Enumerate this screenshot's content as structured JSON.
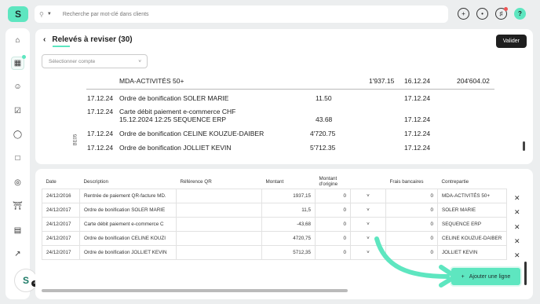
{
  "app": {
    "logo_text": "S"
  },
  "search": {
    "placeholder": "Recherche par mot-clé dans clients"
  },
  "top_icons": [
    "add-circle-icon",
    "clock-icon",
    "bell-icon",
    "help-icon"
  ],
  "help_label": "?",
  "sidebar": {
    "items": [
      "home-icon",
      "inbox-icon",
      "users-icon",
      "checklist-icon",
      "money-bag-icon",
      "shopping-bag-icon",
      "support-icon",
      "bank-icon",
      "document-icon",
      "chart-icon"
    ]
  },
  "avatar": {
    "initials": "S",
    "badge": "42"
  },
  "page": {
    "title": "Relevés à reviser (30)",
    "validate_label": "Valider",
    "account_select_placeholder": "Sélectionner compte"
  },
  "scan": {
    "side_code": "BE05",
    "rows": [
      {
        "label": "MDA-ACTIVITÉS 50+",
        "amount": "1'937.15",
        "date": "16.12.24",
        "balance": "204'604.02"
      },
      {
        "date1": "17.12.24",
        "label": "Ordre de bonification SOLER MARIE",
        "amount": "11.50",
        "date2": "17.12.24"
      },
      {
        "date1": "17.12.24",
        "label": "Carte débit paiement e-commerce CHF",
        "label2": "15.12.2024 12:25 SEQUENCE ERP",
        "amount": "43.68",
        "date2": "17.12.24"
      },
      {
        "date1": "17.12.24",
        "label": "Ordre de bonification CELINE KOUZUE-DAIBER",
        "amount": "4'720.75",
        "date2": "17.12.24"
      },
      {
        "date1": "17.12.24",
        "label": "Ordre de bonification JOLLIET KEVIN",
        "amount": "5'712.35",
        "date2": "17.12.24"
      }
    ]
  },
  "table": {
    "headers": [
      "Date",
      "Description",
      "Référence QR",
      "Montant",
      "Montant d'origine",
      "",
      "Frais bancaires",
      "Contrepartie"
    ],
    "rows": [
      [
        "24/12/2016",
        "Rentrée de paiement QR-facture MD.",
        "",
        "1937,15",
        "0",
        "",
        "0",
        "MDA-ACTIVITÉS 50+"
      ],
      [
        "24/12/2017",
        "Ordre de bonification SOLER MARIE",
        "",
        "11,5",
        "0",
        "",
        "0",
        "SOLER MARIE"
      ],
      [
        "24/12/2017",
        "Carte débit paiement e-commerce C",
        "",
        "-43,68",
        "0",
        "",
        "0",
        "SEQUENCE ERP"
      ],
      [
        "24/12/2017",
        "Ordre de bonification CELINE KOUZI",
        "",
        "4720,75",
        "0",
        "",
        "0",
        "CELINE KOUZUE-DAIBER"
      ],
      [
        "24/12/2017",
        "Ordre de bonification JOLLIET KEVIN",
        "",
        "5712,35",
        "0",
        "",
        "0",
        "JOLLIET KEVIN"
      ]
    ],
    "add_line_label": "Ajouter une ligne"
  },
  "colors": {
    "accent": "#5ee6c0",
    "dark_button": "#1f1f1f"
  }
}
